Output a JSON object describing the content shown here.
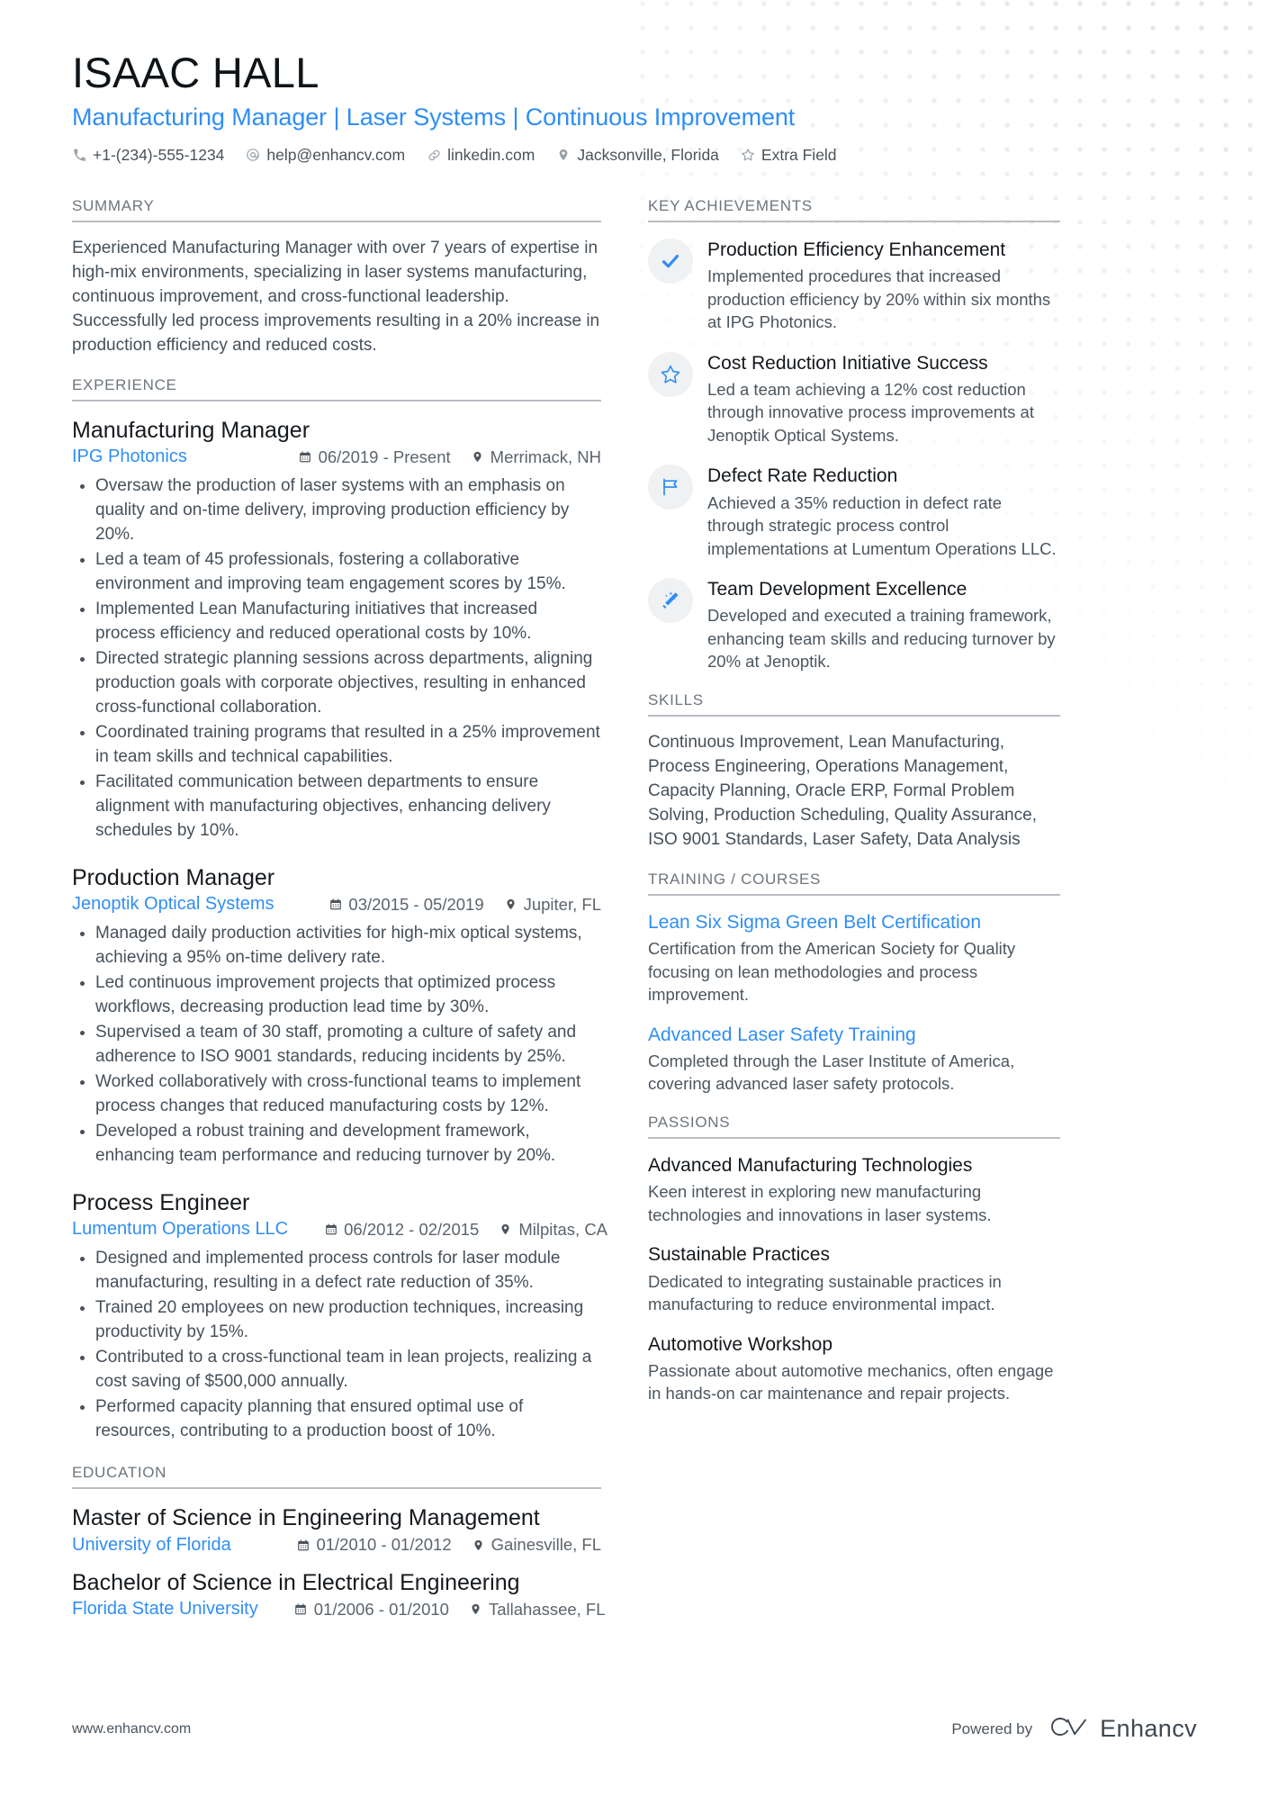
{
  "header": {
    "name": "ISAAC HALL",
    "headline": "Manufacturing Manager | Laser Systems | Continuous Improvement",
    "accent_color": "#2f8ef4",
    "contacts": [
      {
        "icon": "phone-icon",
        "text": "+1-(234)-555-1234"
      },
      {
        "icon": "email-icon",
        "text": "help@enhancv.com"
      },
      {
        "icon": "link-icon",
        "text": "linkedin.com"
      },
      {
        "icon": "location-icon",
        "text": "Jacksonville, Florida"
      },
      {
        "icon": "star-icon",
        "text": "Extra Field"
      }
    ]
  },
  "left": {
    "summary": {
      "title": "SUMMARY",
      "text": "Experienced Manufacturing Manager with over 7 years of expertise in high-mix environments, specializing in laser systems manufacturing, continuous improvement, and cross-functional leadership. Successfully led process improvements resulting in a 20% increase in production efficiency and reduced costs."
    },
    "experience": {
      "title": "EXPERIENCE",
      "entries": [
        {
          "role": "Manufacturing Manager",
          "org": "IPG Photonics",
          "dates": "06/2019 - Present",
          "location": "Merrimack, NH",
          "bullets": [
            "Oversaw the production of laser systems with an emphasis on quality and on-time delivery, improving production efficiency by 20%.",
            "Led a team of 45 professionals, fostering a collaborative environment and improving team engagement scores by 15%.",
            "Implemented Lean Manufacturing initiatives that increased process efficiency and reduced operational costs by 10%.",
            "Directed strategic planning sessions across departments, aligning production goals with corporate objectives, resulting in enhanced cross-functional collaboration.",
            "Coordinated training programs that resulted in a 25% improvement in team skills and technical capabilities.",
            "Facilitated communication between departments to ensure alignment with manufacturing objectives, enhancing delivery schedules by 10%."
          ]
        },
        {
          "role": "Production Manager",
          "org": "Jenoptik Optical Systems",
          "dates": "03/2015 - 05/2019",
          "location": "Jupiter, FL",
          "bullets": [
            "Managed daily production activities for high-mix optical systems, achieving a 95% on-time delivery rate.",
            "Led continuous improvement projects that optimized process workflows, decreasing production lead time by 30%.",
            "Supervised a team of 30 staff, promoting a culture of safety and adherence to ISO 9001 standards, reducing incidents by 25%.",
            "Worked collaboratively with cross-functional teams to implement process changes that reduced manufacturing costs by 12%.",
            "Developed a robust training and development framework, enhancing team performance and reducing turnover by 20%."
          ]
        },
        {
          "role": "Process Engineer",
          "org": "Lumentum Operations LLC",
          "dates": "06/2012 - 02/2015",
          "location": "Milpitas, CA",
          "bullets": [
            "Designed and implemented process controls for laser module manufacturing, resulting in a defect rate reduction of 35%.",
            "Trained 20 employees on new production techniques, increasing productivity by 15%.",
            "Contributed to a cross-functional team in lean projects, realizing a cost saving of $500,000 annually.",
            "Performed capacity planning that ensured optimal use of resources, contributing to a production boost of 10%."
          ]
        }
      ]
    },
    "education": {
      "title": "EDUCATION",
      "entries": [
        {
          "degree": "Master of Science in Engineering Management",
          "org": "University of Florida",
          "dates": "01/2010 - 01/2012",
          "location": "Gainesville, FL"
        },
        {
          "degree": "Bachelor of Science in Electrical Engineering",
          "org": "Florida State University",
          "dates": "01/2006 - 01/2010",
          "location": "Tallahassee, FL"
        }
      ]
    }
  },
  "right": {
    "achievements": {
      "title": "KEY ACHIEVEMENTS",
      "items": [
        {
          "icon": "check-icon",
          "title": "Production Efficiency Enhancement",
          "desc": "Implemented procedures that increased production efficiency by 20% within six months at IPG Photonics."
        },
        {
          "icon": "star-outline-icon",
          "title": "Cost Reduction Initiative Success",
          "desc": "Led a team achieving a 12% cost reduction through innovative process improvements at Jenoptik Optical Systems."
        },
        {
          "icon": "flag-icon",
          "title": "Defect Rate Reduction",
          "desc": "Achieved a 35% reduction in defect rate through strategic process control implementations at Lumentum Operations LLC."
        },
        {
          "icon": "magic-wand-icon",
          "title": "Team Development Excellence",
          "desc": "Developed and executed a training framework, enhancing team skills and reducing turnover by 20% at Jenoptik."
        }
      ]
    },
    "skills": {
      "title": "SKILLS",
      "text": "Continuous Improvement, Lean Manufacturing, Process Engineering, Operations Management, Capacity Planning, Oracle ERP, Formal Problem Solving, Production Scheduling, Quality Assurance, ISO 9001 Standards, Laser Safety, Data Analysis"
    },
    "training": {
      "title": "TRAINING / COURSES",
      "items": [
        {
          "title": "Lean Six Sigma Green Belt Certification",
          "desc": "Certification from the American Society for Quality focusing on lean methodologies and process improvement."
        },
        {
          "title": "Advanced Laser Safety Training",
          "desc": "Completed through the Laser Institute of America, covering advanced laser safety protocols."
        }
      ]
    },
    "passions": {
      "title": "PASSIONS",
      "items": [
        {
          "title": "Advanced Manufacturing Technologies",
          "desc": "Keen interest in exploring new manufacturing technologies and innovations in laser systems."
        },
        {
          "title": "Sustainable Practices",
          "desc": "Dedicated to integrating sustainable practices in manufacturing to reduce environmental impact."
        },
        {
          "title": "Automotive Workshop",
          "desc": "Passionate about automotive mechanics, often engage in hands-on car maintenance and repair projects."
        }
      ]
    }
  },
  "footer": {
    "url": "www.enhancv.com",
    "powered_by_label": "Powered by",
    "brand_name": "Enhancv"
  }
}
